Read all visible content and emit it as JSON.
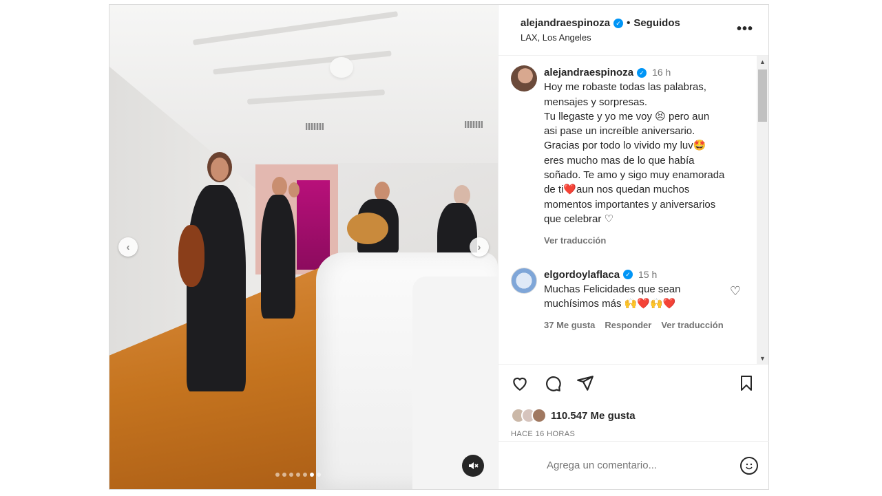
{
  "post": {
    "username": "alejandraespinoza",
    "follow_status": "Seguidos",
    "location": "LAX, Los Angeles",
    "more_icon": "more-horizontal-icon"
  },
  "media": {
    "prev_icon": "chevron-left-icon",
    "next_icon": "chevron-right-icon",
    "carousel_count": 7,
    "carousel_active_index": 5,
    "mute_icon": "speaker-muted-icon"
  },
  "caption": {
    "username": "alejandraespinoza",
    "time": "16 h",
    "text": "Hoy me robaste todas las palabras,\nmensajes y sorpresas.\nTu llegaste y yo me voy 😣 pero aun\nasi pase un increíble aniversario.\nGracias por todo lo vivido my luv🤩\neres mucho mas de lo que había\nsoñado. Te amo y sigo muy enamorada\nde ti❤️aun nos quedan muchos\nmomentos importantes y aniversarios\nque celebrar ♡",
    "translate": "Ver traducción"
  },
  "comment": {
    "username": "elgordoylaflaca",
    "time": "15 h",
    "text": "Muchas Felicidades que sean\nmuchísimos más 🙌❤️🙌❤️",
    "likes": "37 Me gusta",
    "reply": "Responder",
    "translate": "Ver traducción"
  },
  "actions": {
    "like_icon": "heart-icon",
    "comment_icon": "comment-icon",
    "share_icon": "send-icon",
    "save_icon": "bookmark-icon"
  },
  "likes": {
    "count_text": "110.547 Me gusta",
    "time_ago": "HACE 16 HORAS"
  },
  "add_comment": {
    "placeholder": "Agrega un comentario...",
    "emoji_icon": "emoji-icon"
  },
  "colors": {
    "verified": "#0095f6",
    "text": "#262626",
    "secondary": "#737373"
  }
}
